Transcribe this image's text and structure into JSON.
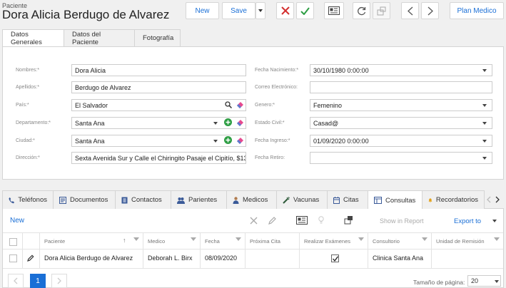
{
  "header": {
    "section": "Paciente",
    "title": "Dora Alicia Berdugo de Alvarez"
  },
  "toolbar": {
    "new_label": "New",
    "save_label": "Save",
    "plan_label": "Plan Medico"
  },
  "colors": {
    "accent": "#1a6fd6",
    "danger": "#d32f2f",
    "success": "#2e9e44",
    "page_active": "#1a6fd6"
  },
  "tabs": [
    "Datos Generales",
    "Datos del Paciente",
    "Fotografía"
  ],
  "form": {
    "nombres": {
      "label": "Nombres:*",
      "value": "Dora Alicia"
    },
    "apellidos": {
      "label": "Apellidos:*",
      "value": "Berdugo de Alvarez"
    },
    "pais": {
      "label": "País:*",
      "value": "El Salvador"
    },
    "departamento": {
      "label": "Departamento:*",
      "value": "Santa Ana"
    },
    "ciudad": {
      "label": "Ciudad:*",
      "value": "Santa Ana"
    },
    "direccion": {
      "label": "Dirección:*",
      "value": "Sexta Avenida Sur y Calle el Chiringito Pasaje el Cipitío, $13"
    },
    "fecha_nacimiento": {
      "label": "Fecha Nacimiento:*",
      "value": "30/10/1980 0:00:00"
    },
    "correo": {
      "label": "Correo Electrónico:",
      "value": ""
    },
    "genero": {
      "label": "Genero:*",
      "value": "Femenino"
    },
    "estado_civil": {
      "label": "Estado Civil:*",
      "value": "Casad@"
    },
    "fecha_ingreso": {
      "label": "Fecha Ingreso:*",
      "value": "01/09/2020 0:00:00"
    },
    "fecha_retiro": {
      "label": "Fecha Retiro:",
      "value": ""
    }
  },
  "subtabs": [
    {
      "label": "Teléfonos",
      "icon": "phone-icon"
    },
    {
      "label": "Documentos",
      "icon": "document-icon"
    },
    {
      "label": "Contactos",
      "icon": "contacts-icon"
    },
    {
      "label": "Parientes",
      "icon": "relatives-icon"
    },
    {
      "label": "Medicos",
      "icon": "doctor-icon"
    },
    {
      "label": "Vacunas",
      "icon": "syringe-icon"
    },
    {
      "label": "Citas",
      "icon": "calendar-icon"
    },
    {
      "label": "Consultas",
      "icon": "consultation-icon"
    },
    {
      "label": "Recordatorios",
      "icon": "reminder-icon"
    }
  ],
  "grid": {
    "new_label": "New",
    "show_report": "Show in Report",
    "export_label": "Export to",
    "columns": [
      "Paciente",
      "Medico",
      "Fecha",
      "Próxima Cita",
      "Realizar Exámenes",
      "Consultorio",
      "Unidad de Remisión"
    ],
    "rows": [
      {
        "paciente": "Dora Alicia Berdugo de Alvarez",
        "medico": "Deborah L. Birx",
        "fecha": "08/09/2020",
        "proxima": "",
        "examenes": true,
        "consultorio": "Clinica Santa Ana",
        "unidad": ""
      }
    ],
    "pager": {
      "current": "1",
      "size_label": "Tamaño de página:",
      "size": "20"
    }
  }
}
